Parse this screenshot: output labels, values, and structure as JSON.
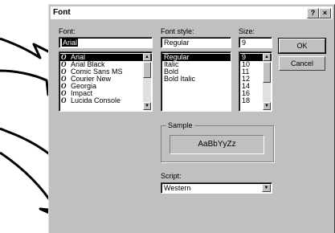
{
  "dialog": {
    "title": "Font",
    "help_button": "?",
    "close_button": "×"
  },
  "font": {
    "label": "Font:",
    "value": "Arial",
    "items": [
      {
        "icon": "O",
        "label": "Arial"
      },
      {
        "icon": "O",
        "label": "Arial Black"
      },
      {
        "icon": "O",
        "label": "Comic Sans MS"
      },
      {
        "icon": "O",
        "label": "Courier New"
      },
      {
        "icon": "O",
        "label": "Georgia"
      },
      {
        "icon": "O",
        "label": "Impact"
      },
      {
        "icon": "O",
        "label": "Lucida Console"
      }
    ]
  },
  "style": {
    "label": "Font style:",
    "value": "Regular",
    "items": [
      "Regular",
      "Italic",
      "Bold",
      "Bold Italic"
    ]
  },
  "size": {
    "label": "Size:",
    "value": "9",
    "items": [
      "9",
      "10",
      "11",
      "12",
      "14",
      "16",
      "18"
    ]
  },
  "buttons": {
    "ok": "OK",
    "cancel": "Cancel"
  },
  "sample": {
    "title": "Sample",
    "text": "AaBbYyZz"
  },
  "script": {
    "label": "Script:",
    "value": "Western"
  },
  "scroll_icons": {
    "up": "▲",
    "down": "▼"
  }
}
